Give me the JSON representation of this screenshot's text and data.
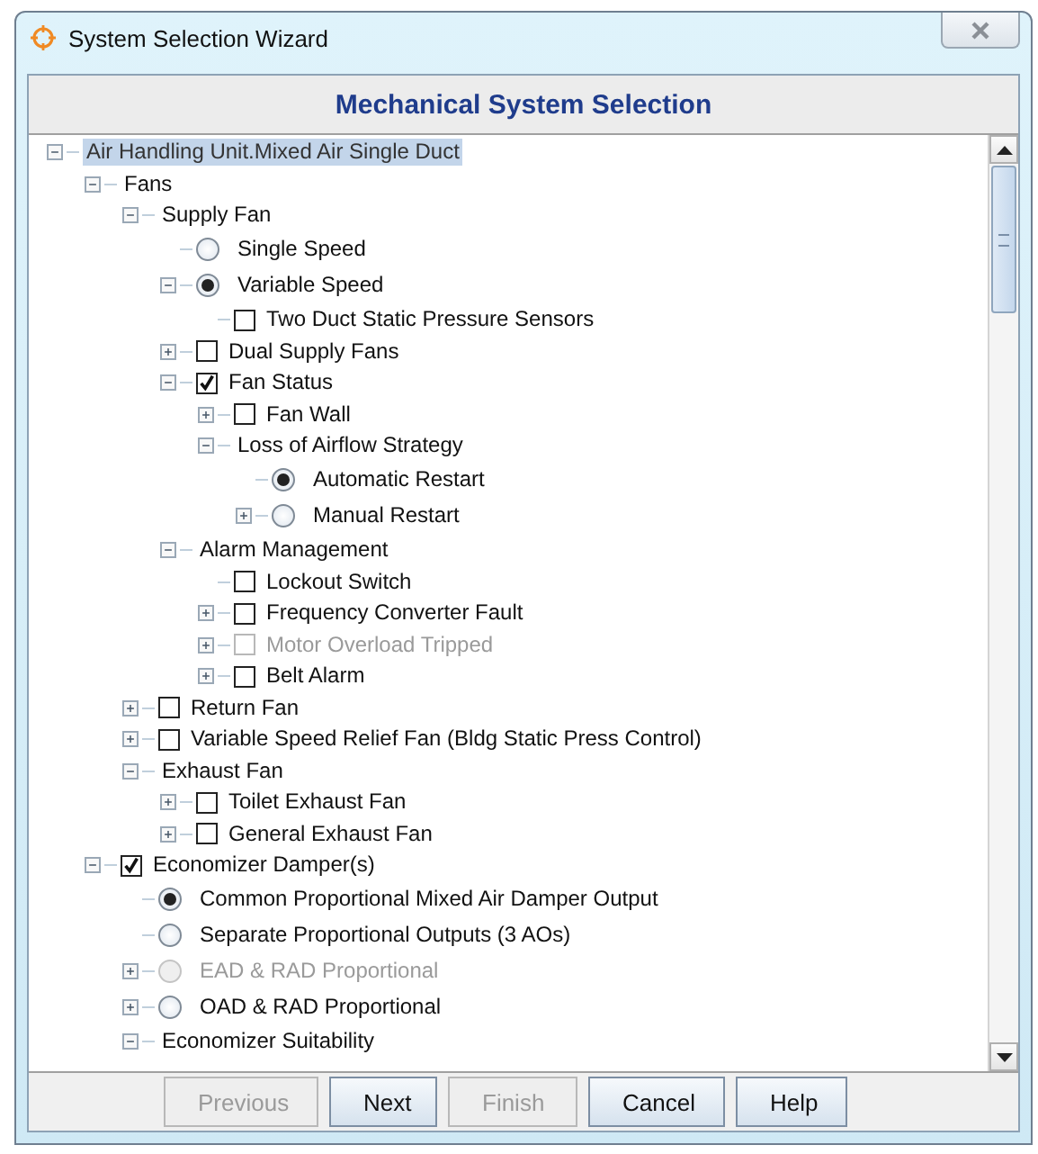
{
  "window": {
    "title": "System Selection Wizard"
  },
  "header": {
    "title": "Mechanical System Selection"
  },
  "tree": {
    "nodes": [
      {
        "label": "Air Handling Unit.Mixed Air Single Duct",
        "kind": "group",
        "expanded": true,
        "selected": true,
        "children": [
          {
            "label": "Fans",
            "kind": "group",
            "expanded": true,
            "selected": false,
            "children": [
              {
                "label": "Supply Fan",
                "kind": "group",
                "expanded": true,
                "selected": false,
                "children": [
                  {
                    "label": "Single Speed",
                    "kind": "radio",
                    "checked": false,
                    "disabled": false,
                    "selected": false
                  },
                  {
                    "label": "Variable Speed",
                    "kind": "radio",
                    "checked": true,
                    "disabled": false,
                    "expanded": true,
                    "selected": false,
                    "children": [
                      {
                        "label": "Two Duct Static Pressure Sensors",
                        "kind": "checkbox",
                        "checked": false,
                        "disabled": false,
                        "selected": false
                      }
                    ]
                  },
                  {
                    "label": "Dual Supply Fans",
                    "kind": "checkbox",
                    "checked": false,
                    "disabled": false,
                    "expanded": false,
                    "selected": false
                  },
                  {
                    "label": "Fan Status",
                    "kind": "checkbox",
                    "checked": true,
                    "disabled": false,
                    "expanded": true,
                    "selected": false,
                    "children": [
                      {
                        "label": "Fan Wall",
                        "kind": "checkbox",
                        "checked": false,
                        "disabled": false,
                        "expanded": false,
                        "selected": false
                      },
                      {
                        "label": "Loss of Airflow Strategy",
                        "kind": "group",
                        "expanded": true,
                        "selected": false,
                        "children": [
                          {
                            "label": "Automatic Restart",
                            "kind": "radio",
                            "checked": true,
                            "disabled": false,
                            "selected": false
                          },
                          {
                            "label": "Manual Restart",
                            "kind": "radio",
                            "checked": false,
                            "disabled": false,
                            "expanded": false,
                            "selected": false
                          }
                        ]
                      }
                    ]
                  },
                  {
                    "label": "Alarm Management",
                    "kind": "group",
                    "expanded": true,
                    "selected": false,
                    "children": [
                      {
                        "label": "Lockout Switch",
                        "kind": "checkbox",
                        "checked": false,
                        "disabled": false,
                        "selected": false
                      },
                      {
                        "label": "Frequency Converter Fault",
                        "kind": "checkbox",
                        "checked": false,
                        "disabled": false,
                        "expanded": false,
                        "selected": false
                      },
                      {
                        "label": "Motor Overload Tripped",
                        "kind": "checkbox",
                        "checked": false,
                        "disabled": true,
                        "expanded": false,
                        "selected": false
                      },
                      {
                        "label": "Belt Alarm",
                        "kind": "checkbox",
                        "checked": false,
                        "disabled": false,
                        "expanded": false,
                        "selected": false
                      }
                    ]
                  }
                ]
              },
              {
                "label": "Return Fan",
                "kind": "checkbox",
                "checked": false,
                "disabled": false,
                "expanded": false,
                "selected": false
              },
              {
                "label": "Variable Speed Relief Fan (Bldg Static Press Control)",
                "kind": "checkbox",
                "checked": false,
                "disabled": false,
                "expanded": false,
                "selected": false
              },
              {
                "label": "Exhaust Fan",
                "kind": "group",
                "expanded": true,
                "selected": false,
                "children": [
                  {
                    "label": "Toilet Exhaust Fan",
                    "kind": "checkbox",
                    "checked": false,
                    "disabled": false,
                    "expanded": false,
                    "selected": false
                  },
                  {
                    "label": "General Exhaust Fan",
                    "kind": "checkbox",
                    "checked": false,
                    "disabled": false,
                    "expanded": false,
                    "selected": false
                  }
                ]
              }
            ]
          },
          {
            "label": "Economizer Damper(s)",
            "kind": "checkbox",
            "checked": true,
            "disabled": false,
            "expanded": true,
            "selected": false,
            "children": [
              {
                "label": "Common Proportional Mixed Air Damper Output",
                "kind": "radio",
                "checked": true,
                "disabled": false,
                "selected": false
              },
              {
                "label": "Separate Proportional Outputs (3 AOs)",
                "kind": "radio",
                "checked": false,
                "disabled": false,
                "selected": false
              },
              {
                "label": "EAD & RAD Proportional",
                "kind": "radio",
                "checked": false,
                "disabled": true,
                "expanded": false,
                "selected": false
              },
              {
                "label": "OAD & RAD Proportional",
                "kind": "radio",
                "checked": false,
                "disabled": false,
                "expanded": false,
                "selected": false
              },
              {
                "label": "Economizer Suitability",
                "kind": "group",
                "expanded": true,
                "selected": false
              }
            ]
          }
        ]
      }
    ]
  },
  "buttons": [
    {
      "label": "Previous",
      "disabled": true
    },
    {
      "label": "Next",
      "disabled": false
    },
    {
      "label": "Finish",
      "disabled": true
    },
    {
      "label": "Cancel",
      "disabled": false
    },
    {
      "label": "Help",
      "disabled": false
    }
  ]
}
